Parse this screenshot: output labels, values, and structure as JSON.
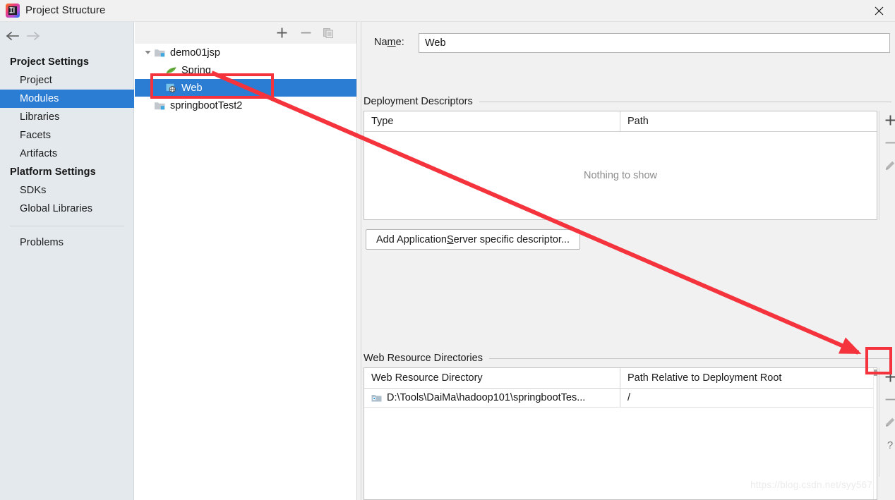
{
  "window": {
    "title": "Project Structure",
    "app_icon": "intellij-idea-icon",
    "close_icon": "close-icon"
  },
  "nav": {
    "back_icon": "arrow-left-icon",
    "forward_icon": "arrow-right-icon"
  },
  "sidebar": {
    "groups": [
      {
        "header": "Project Settings",
        "items": [
          {
            "label": "Project",
            "selected": false
          },
          {
            "label": "Modules",
            "selected": true
          },
          {
            "label": "Libraries",
            "selected": false
          },
          {
            "label": "Facets",
            "selected": false
          },
          {
            "label": "Artifacts",
            "selected": false
          }
        ]
      },
      {
        "header": "Platform Settings",
        "items": [
          {
            "label": "SDKs",
            "selected": false
          },
          {
            "label": "Global Libraries",
            "selected": false
          }
        ]
      }
    ],
    "extra": {
      "label": "Problems"
    }
  },
  "tree_panel": {
    "toolbar": {
      "add_icon": "plus-icon",
      "remove_icon": "minus-icon",
      "copy_icon": "copy-icon"
    },
    "nodes": [
      {
        "label": "demo01jsp",
        "icon": "module-folder-icon",
        "level": 1,
        "expanded": true,
        "selected": false
      },
      {
        "label": "Spring",
        "icon": "spring-leaf-icon",
        "level": 2,
        "expanded": null,
        "selected": false
      },
      {
        "label": "Web",
        "icon": "web-globe-icon",
        "level": 2,
        "expanded": null,
        "selected": true
      },
      {
        "label": "springbootTest2",
        "icon": "module-folder-icon",
        "level": 1,
        "expanded": null,
        "selected": false
      }
    ]
  },
  "content": {
    "name_field": {
      "label_before": "Na",
      "label_mnemonic": "m",
      "label_after": "e:",
      "value": "Web",
      "placeholder": ""
    },
    "deployment_descriptors": {
      "section_label": "Deployment Descriptors",
      "columns": [
        "Type",
        "Path"
      ],
      "rows": [],
      "empty_text": "Nothing to show",
      "toolbar": [
        {
          "icon": "plus-icon",
          "name": "add-descriptor-button"
        },
        {
          "icon": "minus-icon",
          "name": "remove-descriptor-button"
        },
        {
          "icon": "pencil-icon",
          "name": "edit-descriptor-button"
        }
      ],
      "add_button": {
        "text_before": "Add Application ",
        "mnemonic": "S",
        "text_after": "erver specific descriptor..."
      }
    },
    "web_resource_directories": {
      "section_label": "Web Resource Directories",
      "columns": [
        "Web Resource Directory",
        "Path Relative to Deployment Root"
      ],
      "rows": [
        {
          "icon": "folder-resource-icon",
          "directory": "D:\\Tools\\DaiMa\\hadoop101\\springbootTes...",
          "relative_path": "/"
        }
      ],
      "toolbar": [
        {
          "icon": "plus-icon",
          "name": "add-web-resource-button"
        },
        {
          "icon": "minus-icon",
          "name": "remove-web-resource-button"
        },
        {
          "icon": "pencil-icon",
          "name": "edit-web-resource-button"
        },
        {
          "icon": "question-icon",
          "name": "help-button"
        }
      ]
    }
  },
  "annotations": {
    "highlight_color": "#f4333d",
    "boxes": [
      {
        "name": "web-module-highlight"
      },
      {
        "name": "add-web-resource-highlight"
      }
    ],
    "arrow": {
      "from": "web-module-highlight",
      "to": "add-web-resource-highlight"
    }
  },
  "watermark": {
    "text": "https://blog.csdn.net/syy567"
  }
}
